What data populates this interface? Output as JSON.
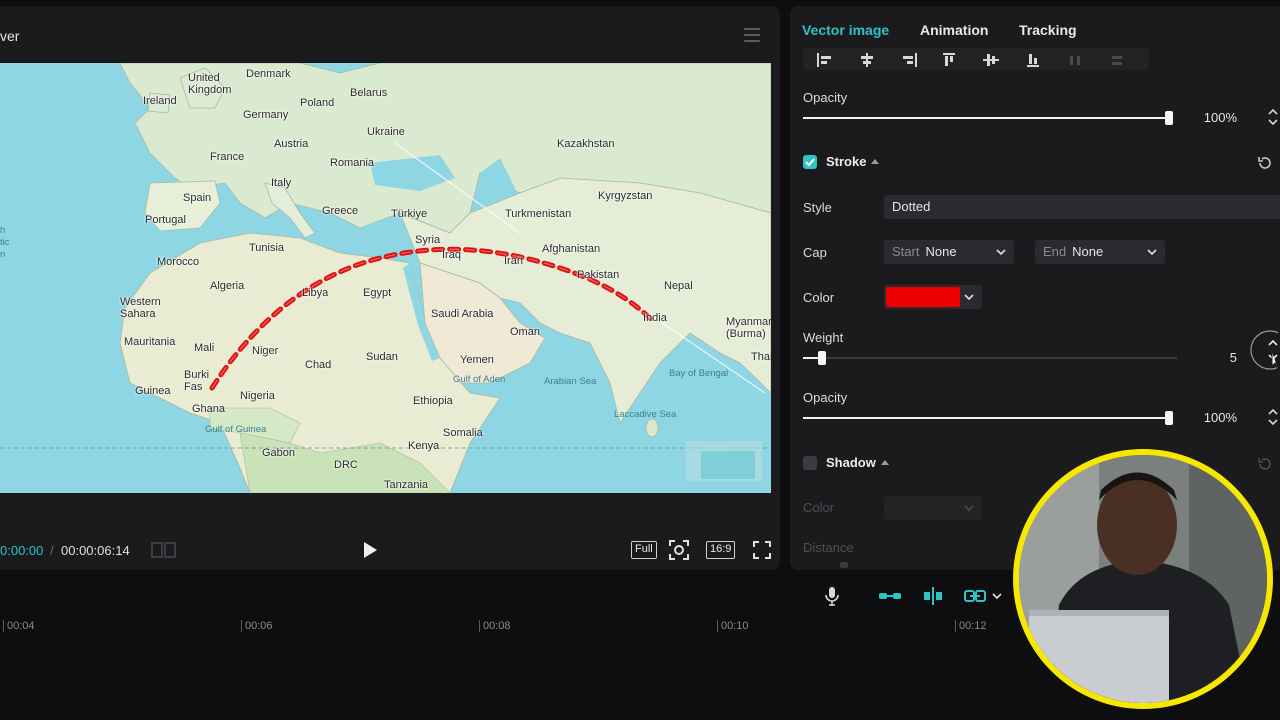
{
  "player": {
    "title": "ver",
    "time_current": "0:00:00",
    "time_separator": "/",
    "time_total": "00:00:06:14",
    "full_label": "Full",
    "ratio_label": "16:9"
  },
  "map": {
    "labels": {
      "denmark": "Denmark",
      "uk": "United\nKingdom",
      "ireland": "Ireland",
      "belarus": "Belarus",
      "poland": "Poland",
      "germany": "Germany",
      "ukraine": "Ukraine",
      "austria": "Austria",
      "france": "France",
      "romania": "Romania",
      "kazakhstan": "Kazakhstan",
      "italy": "Italy",
      "spain": "Spain",
      "kyrgyzstan": "Kyrgyzstan",
      "greece": "Greece",
      "turkiye": "Türkiye",
      "turkmenistan": "Turkmenistan",
      "portugal": "Portugal",
      "syria": "Syria",
      "tunisia": "Tunisia",
      "iraq": "Iraq",
      "afghanistan": "Afghanistan",
      "iran": "Iran",
      "morocco": "Morocco",
      "pakistan": "Pakistan",
      "algeria": "Algeria",
      "nepal": "Nepal",
      "libya": "Libya",
      "egypt": "Egypt",
      "western_sahara": "Western\nSahara",
      "saudi": "Saudi Arabia",
      "india": "India",
      "oman": "Oman",
      "myanmar": "Myanmar\n(Burma)",
      "mauritania": "Mauritania",
      "mali": "Mali",
      "niger": "Niger",
      "chad": "Chad",
      "sudan": "Sudan",
      "yemen": "Yemen",
      "thai": "Thai",
      "burkina": "Burki\nFas",
      "gulf_aden": "Gulf of Aden",
      "arabian_sea": "Arabian Sea",
      "bay_bengal": "Bay of Bengal",
      "guinea": "Guinea",
      "nigeria": "Nigeria",
      "ethiopia": "Ethiopia",
      "ghana": "Ghana",
      "laccadive": "Laccadive Sea",
      "gulf_guinea": "Gulf of Guinea",
      "somalia": "Somalia",
      "kenya": "Kenya",
      "gabon": "Gabon",
      "drc": "DRC",
      "tanzania": "Tanzania",
      "atlantic": "h\ntic\nn"
    }
  },
  "props": {
    "tabs": {
      "vector": "Vector image",
      "animation": "Animation",
      "tracking": "Tracking"
    },
    "opacity1": {
      "label": "Opacity",
      "value": "100%",
      "fraction": 1.0
    },
    "stroke": {
      "label": "Stroke",
      "enabled": true
    },
    "style": {
      "label": "Style",
      "value": "Dotted"
    },
    "cap": {
      "label": "Cap",
      "start_prefix": "Start",
      "start_value": "None",
      "end_prefix": "End",
      "end_value": "None"
    },
    "color": {
      "label": "Color",
      "swatch": "#ee0000"
    },
    "weight": {
      "label": "Weight",
      "value": "5",
      "fraction": 0.05
    },
    "opacity2": {
      "label": "Opacity",
      "value": "100%",
      "fraction": 1.0
    },
    "shadow": {
      "label": "Shadow",
      "enabled": false
    },
    "shadow_color": {
      "label": "Color"
    },
    "distance": {
      "label": "Distance"
    }
  },
  "timeline": {
    "ticks": [
      "00:04",
      "00:06",
      "00:08",
      "00:10",
      "00:12"
    ]
  },
  "colors": {
    "accent": "#2fc3c4",
    "webcam_ring": "#f6e800",
    "route": "#e01010"
  }
}
